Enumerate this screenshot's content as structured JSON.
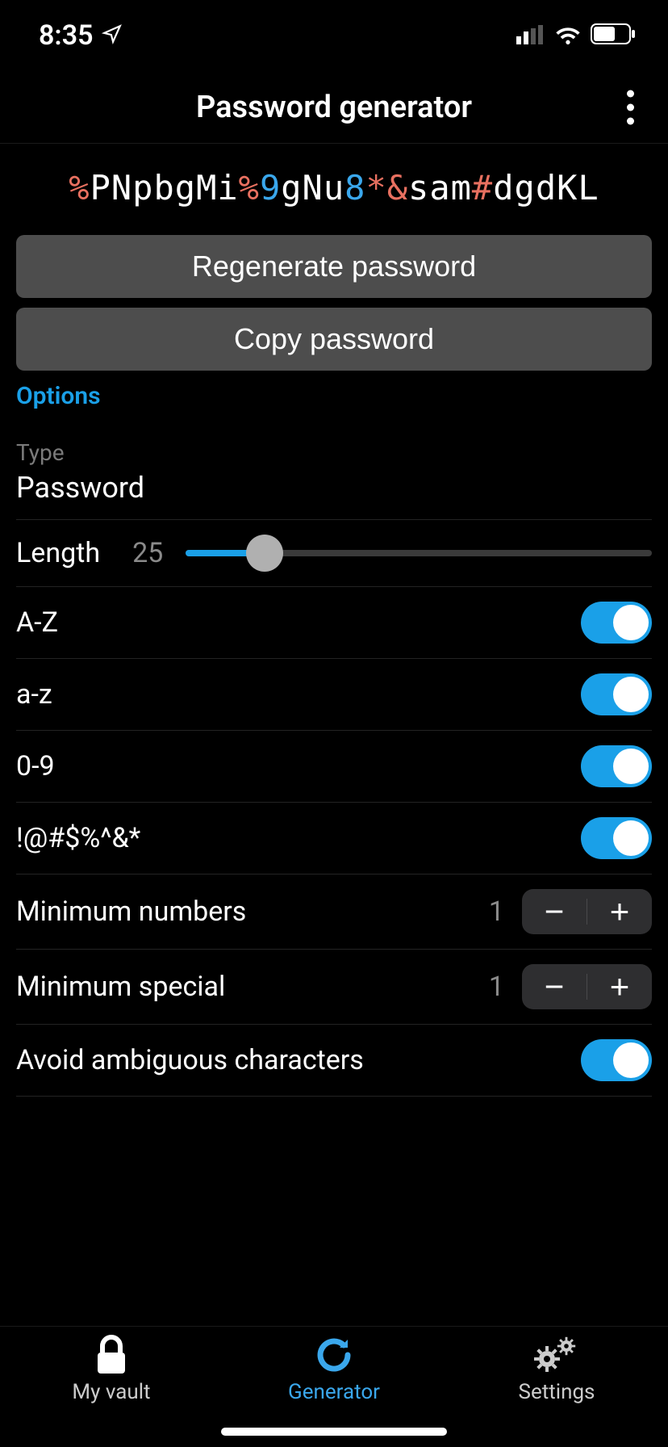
{
  "status": {
    "time": "8:35"
  },
  "header": {
    "title": "Password generator"
  },
  "password": {
    "segments": [
      {
        "t": "%",
        "c": "symbol"
      },
      {
        "t": "P",
        "c": "letter"
      },
      {
        "t": "N",
        "c": "letter"
      },
      {
        "t": "p",
        "c": "letter"
      },
      {
        "t": "b",
        "c": "letter"
      },
      {
        "t": "g",
        "c": "letter"
      },
      {
        "t": "M",
        "c": "letter"
      },
      {
        "t": "i",
        "c": "letter"
      },
      {
        "t": "%",
        "c": "symbol"
      },
      {
        "t": "9",
        "c": "digit"
      },
      {
        "t": "g",
        "c": "letter"
      },
      {
        "t": "N",
        "c": "letter"
      },
      {
        "t": "u",
        "c": "letter"
      },
      {
        "t": "8",
        "c": "digit"
      },
      {
        "t": "*",
        "c": "symbol"
      },
      {
        "t": "&",
        "c": "symbol"
      },
      {
        "t": "s",
        "c": "letter"
      },
      {
        "t": "a",
        "c": "letter"
      },
      {
        "t": "m",
        "c": "letter"
      },
      {
        "t": "#",
        "c": "symbol"
      },
      {
        "t": "d",
        "c": "letter"
      },
      {
        "t": "g",
        "c": "letter"
      },
      {
        "t": "d",
        "c": "letter"
      },
      {
        "t": "K",
        "c": "letter"
      },
      {
        "t": "L",
        "c": "letter"
      }
    ]
  },
  "buttons": {
    "regenerate": "Regenerate password",
    "copy": "Copy password"
  },
  "options": {
    "heading": "Options",
    "type_label": "Type",
    "type_value": "Password",
    "length_label": "Length",
    "length_value": "25",
    "slider_percent": 17,
    "upper_label": "A-Z",
    "lower_label": "a-z",
    "digits_label": "0-9",
    "special_label": "!@#$%^&*",
    "min_numbers_label": "Minimum numbers",
    "min_numbers_value": "1",
    "min_special_label": "Minimum special",
    "min_special_value": "1",
    "avoid_label": "Avoid ambiguous characters",
    "minus": "−",
    "plus": "+"
  },
  "tabs": {
    "vault": "My vault",
    "generator": "Generator",
    "settings": "Settings"
  }
}
